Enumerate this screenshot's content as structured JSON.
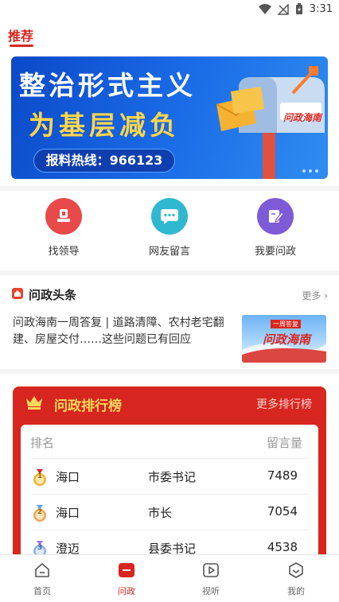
{
  "status_bar": {
    "time": "3:31"
  },
  "top_tabs": {
    "active": "推荐"
  },
  "banner": {
    "line1": "整治形式主义",
    "line2": "为基层减负",
    "hotline": "报料热线：966123",
    "badge": "问政海南"
  },
  "quick_entries": [
    {
      "label": "找领导",
      "color": "#e84a4a",
      "icon": "stamp-icon"
    },
    {
      "label": "网友留言",
      "color": "#2fb8d0",
      "icon": "chat-icon"
    },
    {
      "label": "我要问政",
      "color": "#7d5bd6",
      "icon": "edit-icon"
    }
  ],
  "headline": {
    "title": "问政头条",
    "more": "更多",
    "article": "问政海南一周答复 | 道路清障、农村老宅翻建、房屋交付……这些问题已有回应",
    "thumb_title": "问政海南",
    "thumb_tag": "一周答复"
  },
  "ranking": {
    "title": "问政排行榜",
    "more": "更多排行榜",
    "col_rank": "排名",
    "col_count": "留言量",
    "rows": [
      {
        "rank": "1",
        "city": "海口",
        "post": "市委书记",
        "count": "7489",
        "medal_color": "#f0b43c"
      },
      {
        "rank": "2",
        "city": "海口",
        "post": "市长",
        "count": "7054",
        "medal_color": "#e8a857"
      },
      {
        "rank": "3",
        "city": "澄迈",
        "post": "县委书记",
        "count": "4538",
        "medal_color": "#8fb2e8"
      }
    ]
  },
  "bottom_nav": [
    {
      "label": "首页",
      "icon": "home-icon",
      "active": false
    },
    {
      "label": "问政",
      "icon": "wenzheng-icon",
      "active": true
    },
    {
      "label": "视听",
      "icon": "play-icon",
      "active": false
    },
    {
      "label": "我的",
      "icon": "profile-icon",
      "active": false
    }
  ],
  "colors": {
    "brand_red": "#d7261f",
    "banner_blue": "#1a6ae6",
    "rank_gold": "#ffd95a"
  }
}
